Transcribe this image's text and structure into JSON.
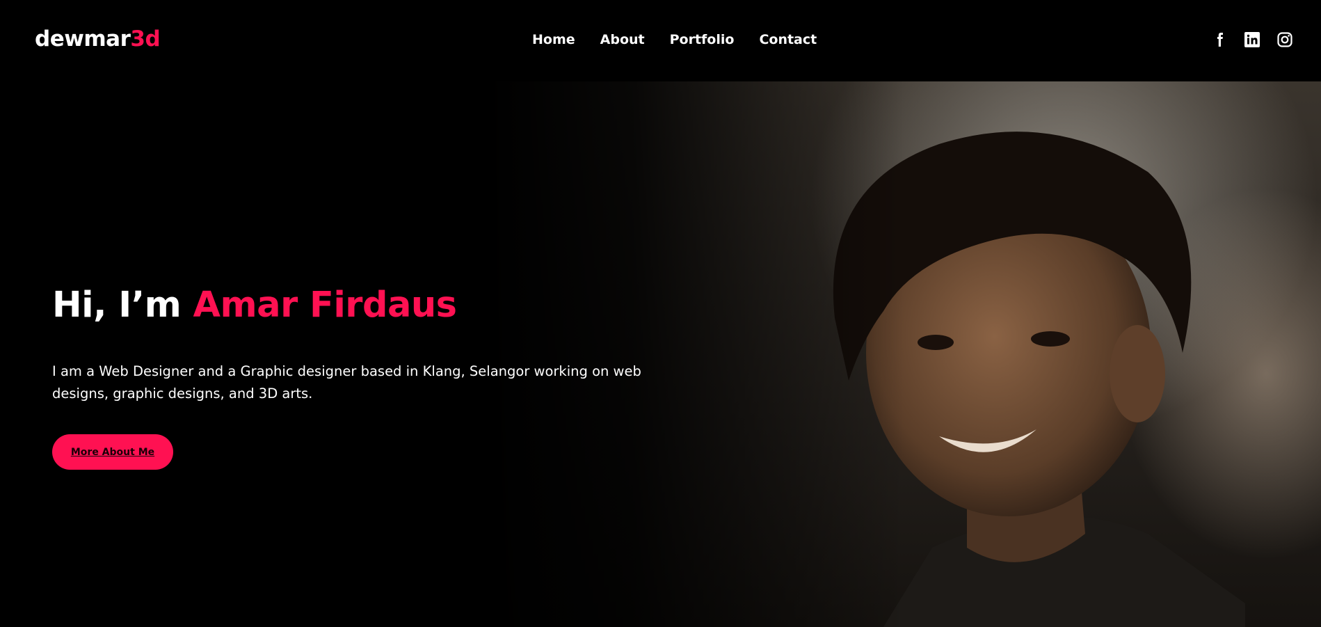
{
  "brand": {
    "logo_main": "dewmar",
    "logo_accent": "3d"
  },
  "nav": {
    "items": [
      "Home",
      "About",
      "Portfolio",
      "Contact"
    ]
  },
  "social": [
    "facebook-icon",
    "linkedin-icon",
    "instagram-icon"
  ],
  "hero": {
    "title_prefix": "Hi, I’m ",
    "title_name": "Amar Firdaus",
    "description": "I am a Web Designer and a Graphic designer based in Klang, Selangor working on web designs, graphic designs, and 3D arts.",
    "cta_label": "More About Me"
  },
  "colors": {
    "accent": "#ff1152",
    "background": "#000000",
    "text": "#ffffff"
  }
}
